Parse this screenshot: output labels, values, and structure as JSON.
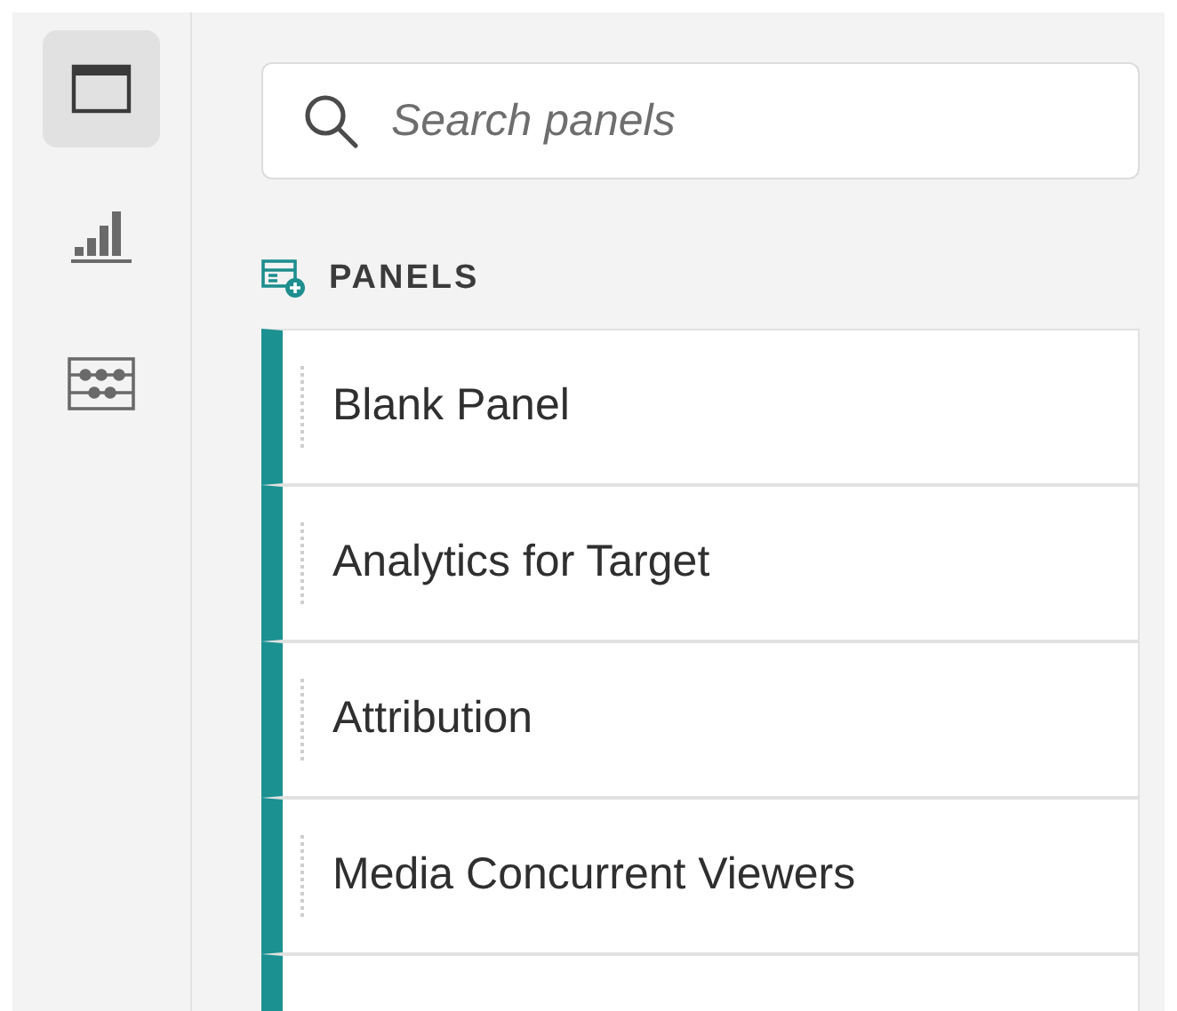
{
  "rail": [
    {
      "kind": "panel",
      "selected": true
    },
    {
      "kind": "visualization",
      "selected": false
    },
    {
      "kind": "components",
      "selected": false
    }
  ],
  "search": {
    "placeholder": "Search panels"
  },
  "section": {
    "title": "PANELS"
  },
  "panels": [
    {
      "label": "Blank Panel"
    },
    {
      "label": "Analytics for Target"
    },
    {
      "label": "Attribution"
    },
    {
      "label": "Media Concurrent Viewers"
    }
  ]
}
